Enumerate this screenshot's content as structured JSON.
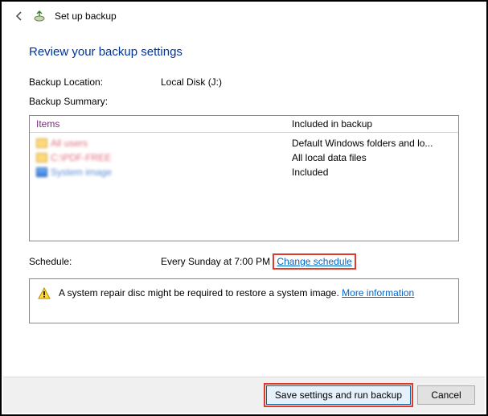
{
  "header": {
    "title": "Set up backup"
  },
  "heading": "Review your backup settings",
  "location": {
    "label": "Backup Location:",
    "value": "Local Disk (J:)"
  },
  "summary": {
    "label": "Backup Summary:",
    "col_items": "Items",
    "col_included": "Included in backup",
    "rows": [
      {
        "item": "All users",
        "included": "Default Windows folders and lo..."
      },
      {
        "item": "C:\\PDF-FREE",
        "included": "All local data files"
      },
      {
        "item": "System image",
        "included": "Included"
      }
    ]
  },
  "schedule": {
    "label": "Schedule:",
    "value": "Every Sunday at 7:00 PM",
    "change_link": "Change schedule"
  },
  "info": {
    "text": "A system repair disc might be required to restore a system image. ",
    "link": "More information"
  },
  "footer": {
    "primary": "Save settings and run backup",
    "cancel": "Cancel"
  }
}
